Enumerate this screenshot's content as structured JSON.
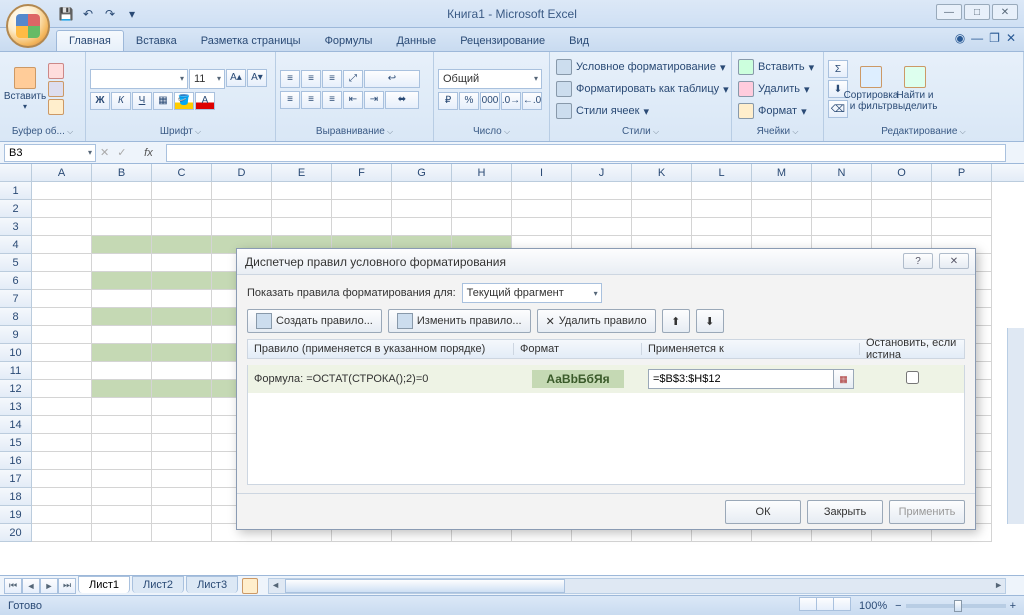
{
  "title": "Книга1 - Microsoft Excel",
  "qat": {
    "save": "💾",
    "undo": "↶",
    "redo": "↷"
  },
  "tabs": [
    "Главная",
    "Вставка",
    "Разметка страницы",
    "Формулы",
    "Данные",
    "Рецензирование",
    "Вид"
  ],
  "ribbon": {
    "clipboard": {
      "label": "Буфер об...",
      "paste": "Вставить"
    },
    "font": {
      "label": "Шрифт",
      "size": "11"
    },
    "alignment": {
      "label": "Выравнивание"
    },
    "number": {
      "label": "Число",
      "format": "Общий"
    },
    "styles": {
      "label": "Стили",
      "cond": "Условное форматирование",
      "table": "Форматировать как таблицу",
      "cell": "Стили ячеек"
    },
    "cells": {
      "label": "Ячейки",
      "ins": "Вставить",
      "del": "Удалить",
      "fmt": "Формат"
    },
    "editing": {
      "label": "Редактирование",
      "sort": "Сортировка и фильтр",
      "find": "Найти и выделить"
    }
  },
  "namebox": "B3",
  "columns": [
    "A",
    "B",
    "C",
    "D",
    "E",
    "F",
    "G",
    "H",
    "I",
    "J",
    "K",
    "L",
    "M",
    "N",
    "O",
    "P"
  ],
  "rows": 20,
  "highlight": {
    "colStart": 1,
    "colEnd": 7,
    "evenRows": [
      4,
      6,
      8,
      10,
      12
    ]
  },
  "dialog": {
    "title": "Диспетчер правил условного форматирования",
    "scopeLabel": "Показать правила форматирования для:",
    "scopeValue": "Текущий фрагмент",
    "new": "Создать правило...",
    "edit": "Изменить правило...",
    "del": "Удалить правило",
    "hdr": {
      "rule": "Правило (применяется в указанном порядке)",
      "fmt": "Формат",
      "apply": "Применяется к",
      "stop": "Остановить, если истина"
    },
    "rule": {
      "text": "Формула: =ОСТАТ(СТРОКА();2)=0",
      "sample": "АаВbБбЯя",
      "range": "=$B$3:$H$12"
    },
    "ok": "ОК",
    "close": "Закрыть",
    "apply": "Применить"
  },
  "sheets": [
    "Лист1",
    "Лист2",
    "Лист3"
  ],
  "status": "Готово",
  "zoom": "100%"
}
